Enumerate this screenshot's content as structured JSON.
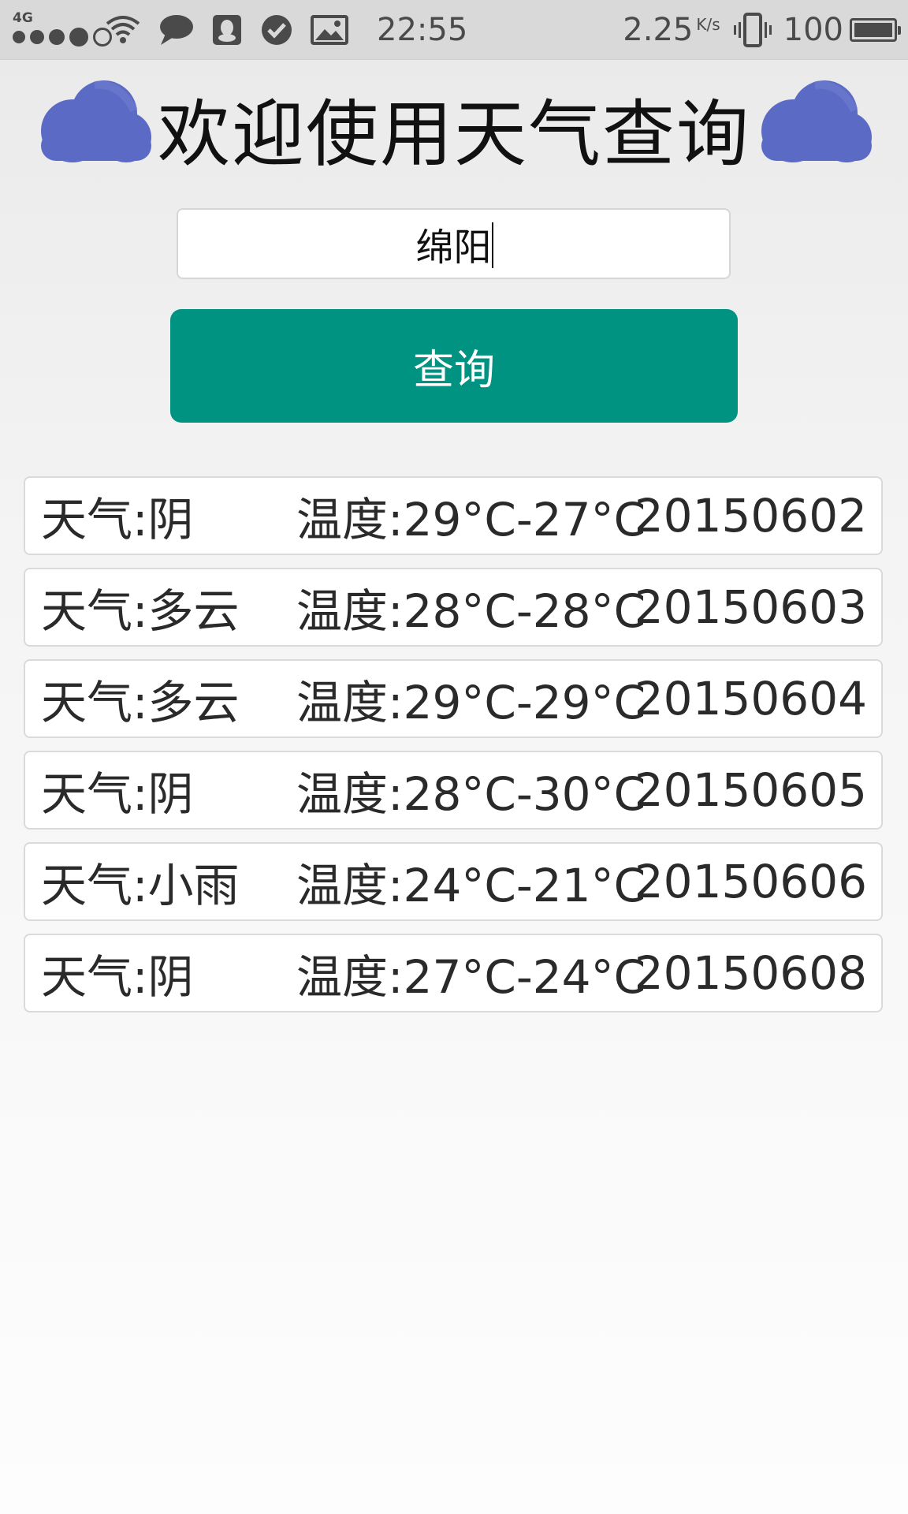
{
  "status_bar": {
    "network": "4G",
    "time": "22:55",
    "speed": "2.25",
    "speed_unit": "K/s",
    "battery": "100",
    "icons": [
      "signal-dots-icon",
      "wifi-icon",
      "chat-bubble-icon",
      "qq-icon",
      "check-circle-icon",
      "image-icon",
      "vibrate-icon",
      "battery-icon"
    ]
  },
  "header": {
    "title": "欢迎使用天气查询",
    "icon_left": "cloud-icon",
    "icon_right": "cloud-icon",
    "cloud_color": "#5b6bc5"
  },
  "search": {
    "value": "绵阳",
    "button_label": "查询",
    "button_color": "#009382"
  },
  "results": [
    {
      "weather": "天气:阴",
      "temp": "温度:29°C-27°C",
      "date": "20150602"
    },
    {
      "weather": "天气:多云",
      "temp": "温度:28°C-28°C",
      "date": "20150603"
    },
    {
      "weather": "天气:多云",
      "temp": "温度:29°C-29°C",
      "date": "20150604"
    },
    {
      "weather": "天气:阴",
      "temp": "温度:28°C-30°C",
      "date": "20150605"
    },
    {
      "weather": "天气:小雨",
      "temp": "温度:24°C-21°C",
      "date": "20150606"
    },
    {
      "weather": "天气:阴",
      "temp": "温度:27°C-24°C",
      "date": "20150608"
    }
  ]
}
